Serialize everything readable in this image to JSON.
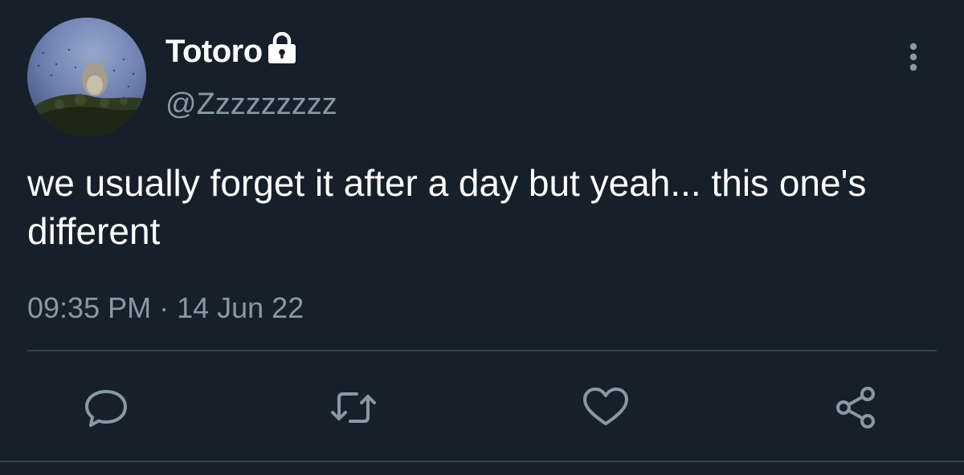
{
  "tweet": {
    "author": {
      "display_name": "Totoro",
      "handle": "@Zzzzzzzzz",
      "protected": true
    },
    "text": "we usually forget it after a day but yeah... this one's different",
    "timestamp": "09:35 PM · 14 Jun 22"
  },
  "actions": [
    {
      "name": "reply",
      "icon": "reply-icon"
    },
    {
      "name": "retweet",
      "icon": "retweet-icon"
    },
    {
      "name": "like",
      "icon": "heart-icon"
    },
    {
      "name": "share",
      "icon": "share-icon"
    }
  ],
  "colors": {
    "background": "#15202b",
    "primary_text": "#ffffff",
    "secondary_text": "#8899a6",
    "divider": "#38444d"
  }
}
